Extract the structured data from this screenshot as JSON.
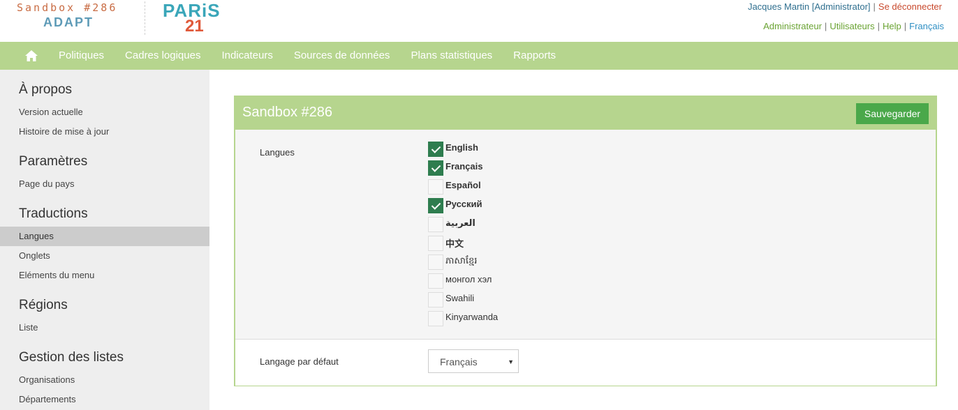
{
  "header": {
    "logo_sandbox": "Sandbox #286",
    "logo_adapt": "ADAPT",
    "logo_paris": "PARiS",
    "logo_21": "21",
    "user_name": "Jacques Martin [Administrator]",
    "logout": "Se déconnecter",
    "links": [
      {
        "label": "Administrateur"
      },
      {
        "label": "Utilisateurs"
      },
      {
        "label": "Help"
      },
      {
        "label": "Français"
      }
    ]
  },
  "nav": {
    "home_icon": "home-icon",
    "items": [
      {
        "label": "Politiques"
      },
      {
        "label": "Cadres logiques"
      },
      {
        "label": "Indicateurs"
      },
      {
        "label": "Sources de données"
      },
      {
        "label": "Plans statistiques"
      },
      {
        "label": "Rapports"
      }
    ]
  },
  "sidebar": {
    "sections": [
      {
        "heading": "À propos",
        "items": [
          "Version actuelle",
          "Histoire de mise à jour"
        ]
      },
      {
        "heading": "Paramètres",
        "items": [
          "Page du pays"
        ]
      },
      {
        "heading": "Traductions",
        "items": [
          "Langues",
          "Onglets",
          "Eléments du menu"
        ]
      },
      {
        "heading": "Régions",
        "items": [
          "Liste"
        ]
      },
      {
        "heading": "Gestion des listes",
        "items": [
          "Organisations",
          "Départements"
        ]
      }
    ],
    "active_item": "Langues"
  },
  "panel": {
    "title": "Sandbox #286",
    "save_label": "Sauvegarder",
    "languages_label": "Langues",
    "languages": [
      {
        "name": "English",
        "checked": true
      },
      {
        "name": "Français",
        "checked": true
      },
      {
        "name": "Español",
        "checked": false
      },
      {
        "name": "Русский",
        "checked": true
      },
      {
        "name": "العربية",
        "checked": false
      },
      {
        "name": "中文",
        "checked": false
      },
      {
        "name": "ភាសាខ្មែរ",
        "checked": false
      },
      {
        "name": "монгол хэл",
        "checked": false
      },
      {
        "name": "Swahili",
        "checked": false
      },
      {
        "name": "Kinyarwanda",
        "checked": false
      }
    ],
    "default_language_label": "Langage par défaut",
    "default_language_value": "Français"
  },
  "colors": {
    "nav_green": "#b6d58e",
    "save_green": "#4aa84a",
    "checkbox_green": "#2e7d4f"
  }
}
